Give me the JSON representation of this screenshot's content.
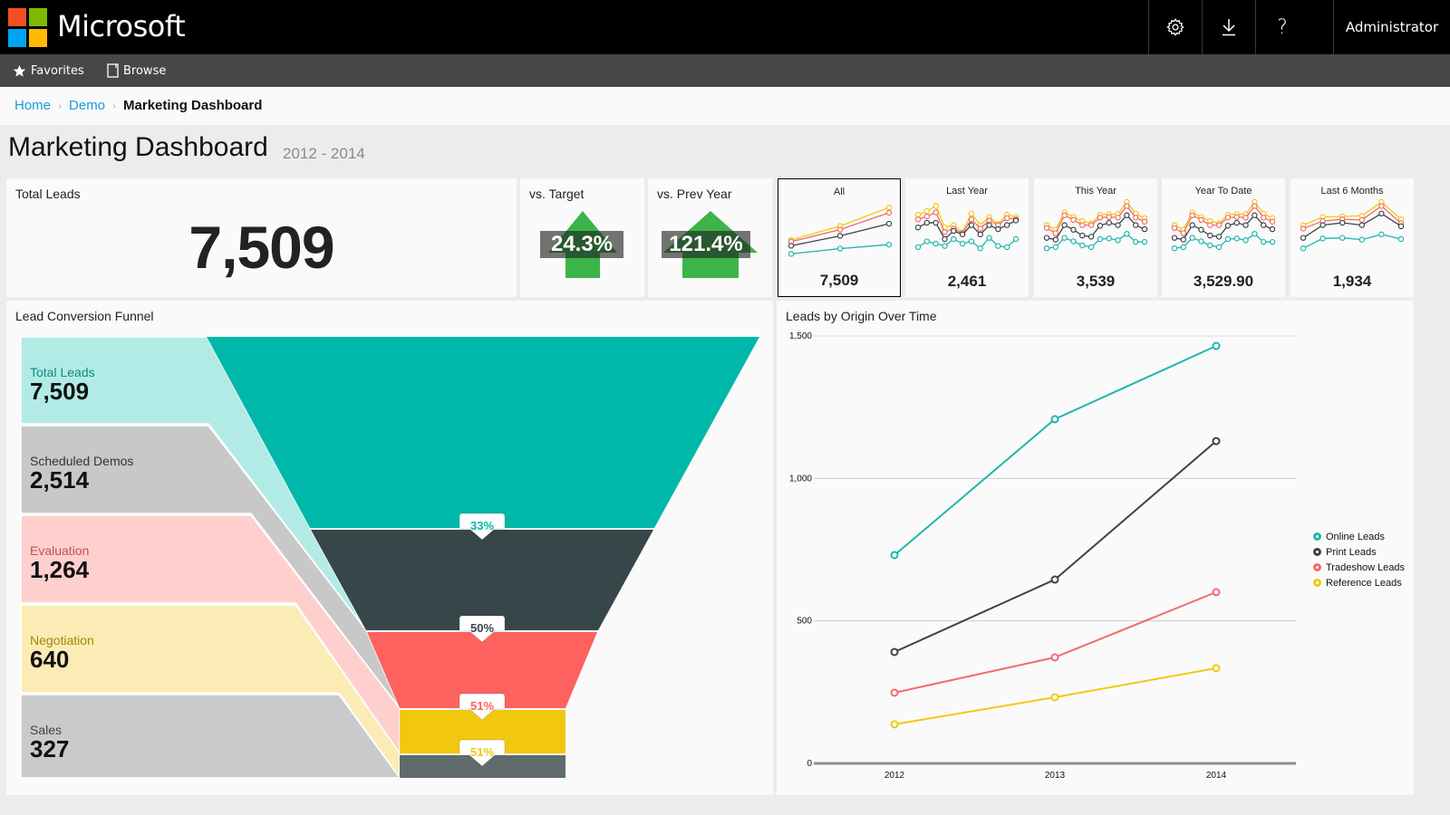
{
  "header": {
    "brand": "Microsoft",
    "logo_colors": [
      "#f25022",
      "#7fba00",
      "#00a4ef",
      "#ffb900"
    ],
    "icons": [
      "gear-icon",
      "download-icon",
      "help-icon"
    ],
    "user": "Administrator"
  },
  "nav": {
    "items": [
      {
        "label": "Favorites",
        "icon": "star-icon"
      },
      {
        "label": "Browse",
        "icon": "document-icon"
      }
    ]
  },
  "breadcrumb": {
    "items": [
      "Home",
      "Demo"
    ],
    "current": "Marketing Dashboard"
  },
  "page": {
    "title": "Marketing Dashboard",
    "subtitle": "2012 - 2014"
  },
  "kpis": {
    "total_leads": {
      "label": "Total Leads",
      "value": "7,509"
    },
    "vs_target": {
      "label": "vs. Target",
      "value": "24.3%",
      "direction": "up"
    },
    "vs_prev_year": {
      "label": "vs. Prev Year",
      "value": "121.4%",
      "direction": "up"
    }
  },
  "colors": {
    "online": "#1fb7aa",
    "print": "#3b4448",
    "tradeshow": "#f46a6a",
    "reference": "#f2c811",
    "arrow_up": "#3cb44a"
  },
  "period_cards": [
    {
      "title": "All",
      "value": "7,509",
      "selected": true,
      "series": {
        "reference": [
          0.36,
          0.6,
          0.92
        ],
        "tradeshow": [
          0.33,
          0.54,
          0.83
        ],
        "print": [
          0.26,
          0.43,
          0.64
        ],
        "online": [
          0.12,
          0.21,
          0.28
        ]
      }
    },
    {
      "title": "Last Year",
      "value": "2,461",
      "selected": false,
      "series": {
        "reference": [
          0.78,
          0.84,
          0.93,
          0.56,
          0.6,
          0.48,
          0.8,
          0.6,
          0.74,
          0.62,
          0.78,
          0.74
        ],
        "tradeshow": [
          0.7,
          0.75,
          0.82,
          0.48,
          0.54,
          0.46,
          0.7,
          0.54,
          0.68,
          0.6,
          0.72,
          0.7
        ],
        "print": [
          0.56,
          0.64,
          0.64,
          0.36,
          0.5,
          0.44,
          0.6,
          0.44,
          0.6,
          0.53,
          0.6,
          0.68
        ],
        "online": [
          0.22,
          0.32,
          0.28,
          0.24,
          0.36,
          0.28,
          0.32,
          0.2,
          0.38,
          0.24,
          0.22,
          0.36
        ]
      }
    },
    {
      "title": "This Year",
      "value": "3,539",
      "selected": false,
      "series": {
        "reference": [
          0.6,
          0.52,
          0.82,
          0.74,
          0.67,
          0.63,
          0.78,
          0.79,
          0.79,
          1.0,
          0.8,
          0.72
        ],
        "tradeshow": [
          0.55,
          0.46,
          0.77,
          0.69,
          0.6,
          0.6,
          0.73,
          0.74,
          0.73,
          0.93,
          0.73,
          0.66
        ],
        "print": [
          0.38,
          0.35,
          0.6,
          0.52,
          0.42,
          0.4,
          0.59,
          0.64,
          0.6,
          0.77,
          0.6,
          0.53
        ],
        "online": [
          0.2,
          0.22,
          0.38,
          0.32,
          0.25,
          0.22,
          0.36,
          0.37,
          0.34,
          0.45,
          0.31,
          0.31
        ]
      }
    },
    {
      "title": "Year To Date",
      "value": "3,529.90",
      "selected": false,
      "series": {
        "reference": [
          0.6,
          0.52,
          0.82,
          0.74,
          0.67,
          0.63,
          0.78,
          0.79,
          0.79,
          1.0,
          0.8,
          0.72
        ],
        "tradeshow": [
          0.55,
          0.46,
          0.77,
          0.69,
          0.6,
          0.6,
          0.73,
          0.74,
          0.73,
          0.93,
          0.73,
          0.66
        ],
        "print": [
          0.38,
          0.35,
          0.6,
          0.52,
          0.42,
          0.4,
          0.59,
          0.64,
          0.6,
          0.77,
          0.6,
          0.53
        ],
        "online": [
          0.2,
          0.22,
          0.38,
          0.32,
          0.25,
          0.22,
          0.36,
          0.37,
          0.34,
          0.45,
          0.31,
          0.31
        ]
      }
    },
    {
      "title": "Last 6 Months",
      "value": "1,934",
      "selected": false,
      "series": {
        "reference": [
          0.6,
          0.74,
          0.75,
          0.76,
          1.0,
          0.7
        ],
        "tradeshow": [
          0.54,
          0.67,
          0.7,
          0.69,
          0.93,
          0.63
        ],
        "print": [
          0.38,
          0.6,
          0.64,
          0.6,
          0.8,
          0.58
        ],
        "online": [
          0.2,
          0.37,
          0.38,
          0.35,
          0.44,
          0.36
        ]
      }
    }
  ],
  "funnel": {
    "title": "Lead Conversion Funnel",
    "stages": [
      {
        "label": "Total Leads",
        "value": "7,509",
        "color": "#00b8aa",
        "band": "#b2ebe5",
        "label_color": "#0e8c80"
      },
      {
        "label": "Scheduled Demos",
        "value": "2,514",
        "color": "#374649",
        "band": "#c8c8c8",
        "label_color": "#333333"
      },
      {
        "label": "Evaluation",
        "value": "1,264",
        "color": "#fd625e",
        "band": "#fdd0ce",
        "label_color": "#c0504d"
      },
      {
        "label": "Negotiation",
        "value": "640",
        "color": "#f2c80f",
        "band": "#faecb4",
        "label_color": "#a38600"
      },
      {
        "label": "Sales",
        "value": "327",
        "color": "#5f6b6d",
        "band": "#c8cacb",
        "label_color": "#444444"
      }
    ],
    "conversions": [
      {
        "value": "33%",
        "color": "#01b8aa"
      },
      {
        "value": "50%",
        "color": "#374649"
      },
      {
        "value": "51%",
        "color": "#fd625e"
      },
      {
        "value": "51%",
        "color": "#f2c80f"
      }
    ]
  },
  "chart_data": {
    "type": "line",
    "title": "Leads by Origin Over Time",
    "x": [
      "2012",
      "2013",
      "2014"
    ],
    "xlabel": "",
    "ylabel": "",
    "ylim": [
      0,
      1500
    ],
    "yticks": [
      "0",
      "500",
      "1,000",
      "1,500"
    ],
    "ytick_values": [
      0,
      500,
      1000,
      1500
    ],
    "grid": true,
    "legend_position": "right",
    "series": [
      {
        "name": "Online Leads",
        "key": "online",
        "color": "#1fb7aa",
        "values": [
          731,
          1208,
          1465
        ]
      },
      {
        "name": "Print Leads",
        "key": "print",
        "color": "#3b4448",
        "values": [
          391,
          645,
          1131
        ]
      },
      {
        "name": "Tradeshow Leads",
        "key": "tradeshow",
        "color": "#f46a6a",
        "values": [
          248,
          372,
          601
        ]
      },
      {
        "name": "Reference Leads",
        "key": "reference",
        "color": "#f2c811",
        "values": [
          137,
          232,
          334
        ]
      }
    ]
  }
}
